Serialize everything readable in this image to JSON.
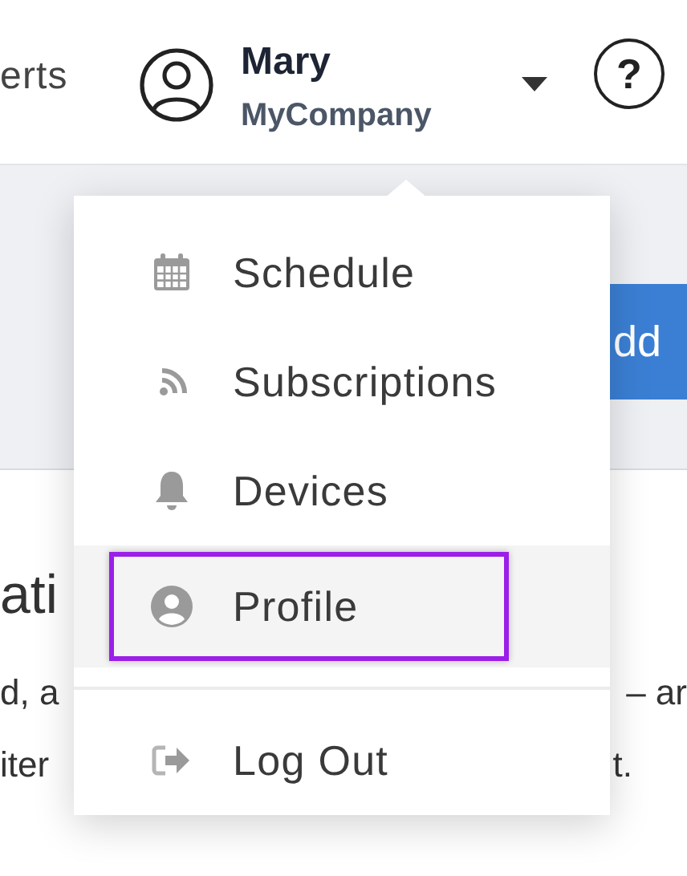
{
  "header": {
    "nav_link": "erts",
    "user": {
      "name": "Mary",
      "company": "MyCompany"
    },
    "help": "?"
  },
  "background": {
    "button": "dd",
    "heading": "ati",
    "lines": [
      {
        "left": "d, a",
        "right": "– ar"
      },
      {
        "left": "iter",
        "right": "t."
      }
    ]
  },
  "menu": {
    "items": [
      {
        "kind": "calendar",
        "label": "Schedule",
        "selected": false
      },
      {
        "kind": "rss",
        "label": "Subscriptions",
        "selected": false
      },
      {
        "kind": "bell",
        "label": "Devices",
        "selected": false
      },
      {
        "kind": "person",
        "label": "Profile",
        "selected": true
      },
      {
        "kind": "logout",
        "label": "Log Out",
        "selected": false
      }
    ]
  }
}
